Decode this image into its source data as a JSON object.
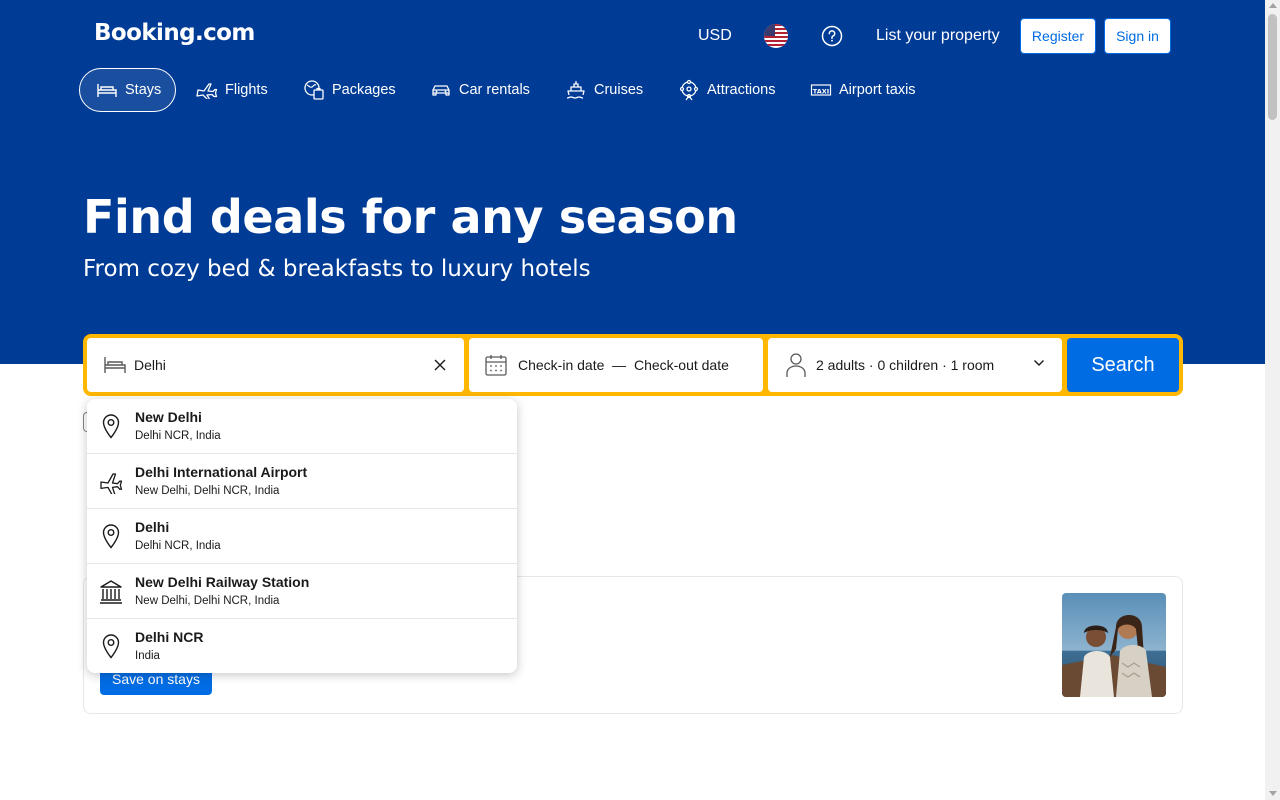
{
  "header": {
    "logo": "Booking.com",
    "currency": "USD",
    "language_flag": "us-flag-icon",
    "help_icon": "help-icon",
    "list_property": "List your property",
    "register": "Register",
    "sign_in": "Sign in"
  },
  "nav": {
    "items": [
      {
        "label": "Stays",
        "icon": "bed-icon",
        "active": true
      },
      {
        "label": "Flights",
        "icon": "plane-icon",
        "active": false
      },
      {
        "label": "Packages",
        "icon": "packages-icon",
        "active": false
      },
      {
        "label": "Car rentals",
        "icon": "car-icon",
        "active": false
      },
      {
        "label": "Cruises",
        "icon": "cruise-icon",
        "active": false
      },
      {
        "label": "Attractions",
        "icon": "attractions-icon",
        "active": false
      },
      {
        "label": "Airport taxis",
        "icon": "taxi-icon",
        "active": false
      }
    ]
  },
  "hero": {
    "title": "Find deals for any season",
    "subtitle": "From cozy bed & breakfasts to luxury hotels"
  },
  "search": {
    "destination_value": "Delhi",
    "checkin": "Check-in date",
    "separator": "—",
    "checkout": "Check-out date",
    "guests": "2 adults · 0 children · 1 room",
    "button": "Search"
  },
  "suggestions": [
    {
      "title": "New Delhi",
      "subtitle": "Delhi NCR, India",
      "icon": "location-pin-icon"
    },
    {
      "title": "Delhi International Airport",
      "subtitle": "New Delhi, Delhi NCR, India",
      "icon": "airport-icon"
    },
    {
      "title": "Delhi",
      "subtitle": "Delhi NCR, India",
      "icon": "location-pin-icon"
    },
    {
      "title": "New Delhi Railway Station",
      "subtitle": "New Delhi, Delhi NCR, India",
      "icon": "landmark-icon"
    },
    {
      "title": "Delhi NCR",
      "subtitle": "India",
      "icon": "location-pin-icon"
    }
  ],
  "promo": {
    "button": "Save on stays"
  },
  "colors": {
    "brand_blue": "#003b95",
    "action_blue": "#006ce4",
    "search_yellow": "#ffb700"
  }
}
